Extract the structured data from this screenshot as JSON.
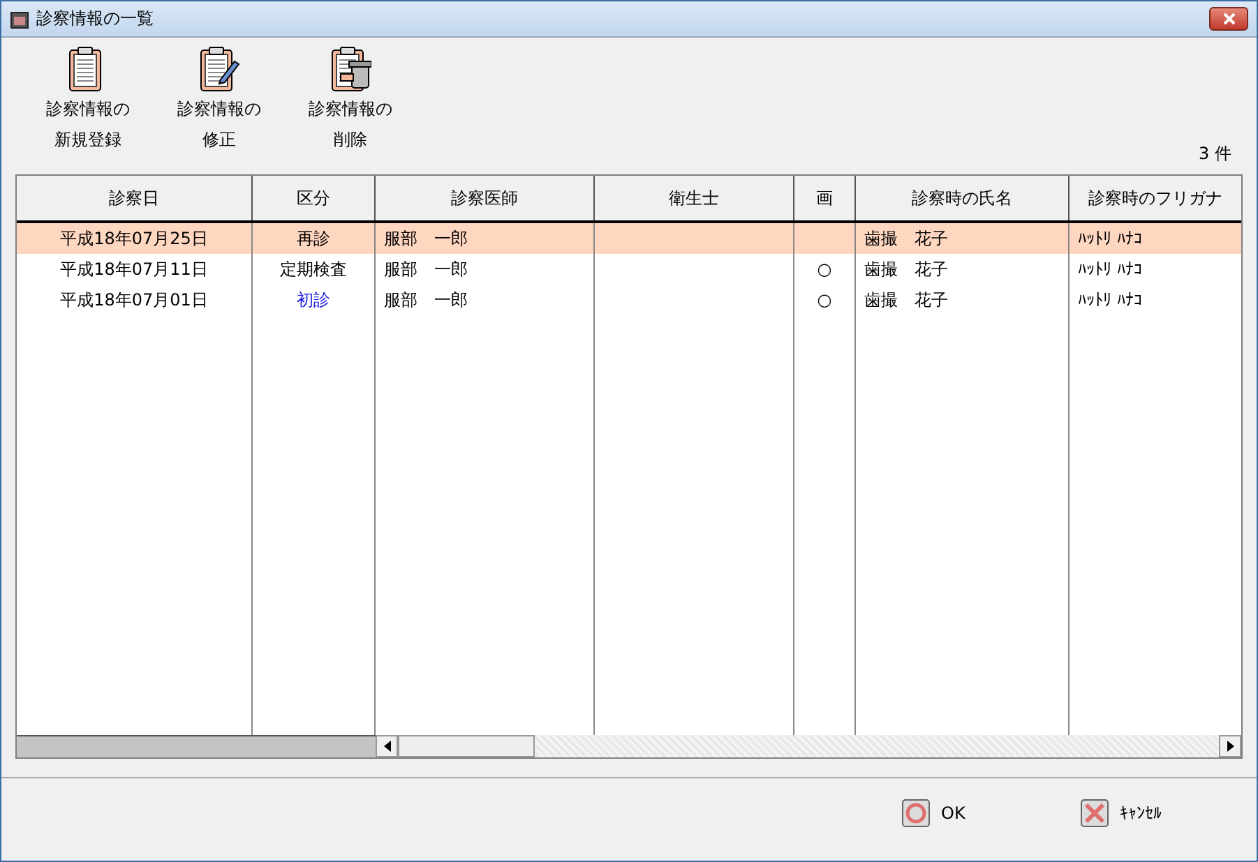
{
  "window": {
    "title": "診察情報の一覧"
  },
  "toolbar": [
    {
      "kind": "new",
      "lines": [
        "診察情報の",
        "新規登録"
      ]
    },
    {
      "kind": "edit",
      "lines": [
        "診察情報の",
        "修正"
      ]
    },
    {
      "kind": "delete",
      "lines": [
        "診察情報の",
        "削除"
      ]
    }
  ],
  "count": "3 件",
  "table": {
    "columns": [
      "診察日",
      "区分",
      "診察医師",
      "衛生士",
      "画",
      "診察時の氏名",
      "診察時のフリガナ"
    ],
    "rows": [
      {
        "selected": true,
        "cells": [
          "平成18年07月25日",
          "再診",
          "服部　一郎",
          "",
          "",
          "歯撮　花子",
          "ﾊｯﾄﾘ ﾊﾅｺ"
        ],
        "color": "#000000"
      },
      {
        "selected": false,
        "cells": [
          "平成18年07月11日",
          "定期検査",
          "服部　一郎",
          "",
          "○",
          "歯撮　花子",
          "ﾊｯﾄﾘ ﾊﾅｺ"
        ],
        "color": "#000000"
      },
      {
        "selected": false,
        "cells": [
          "平成18年07月01日",
          "初診",
          "服部　一郎",
          "",
          "○",
          "歯撮　花子",
          "ﾊｯﾄﾘ ﾊﾅｺ"
        ],
        "color": "#2020e0"
      }
    ]
  },
  "buttons": [
    {
      "kind": "ok",
      "label": "OK"
    },
    {
      "kind": "cancel",
      "label": "ｷｬﾝｾﾙ"
    }
  ]
}
